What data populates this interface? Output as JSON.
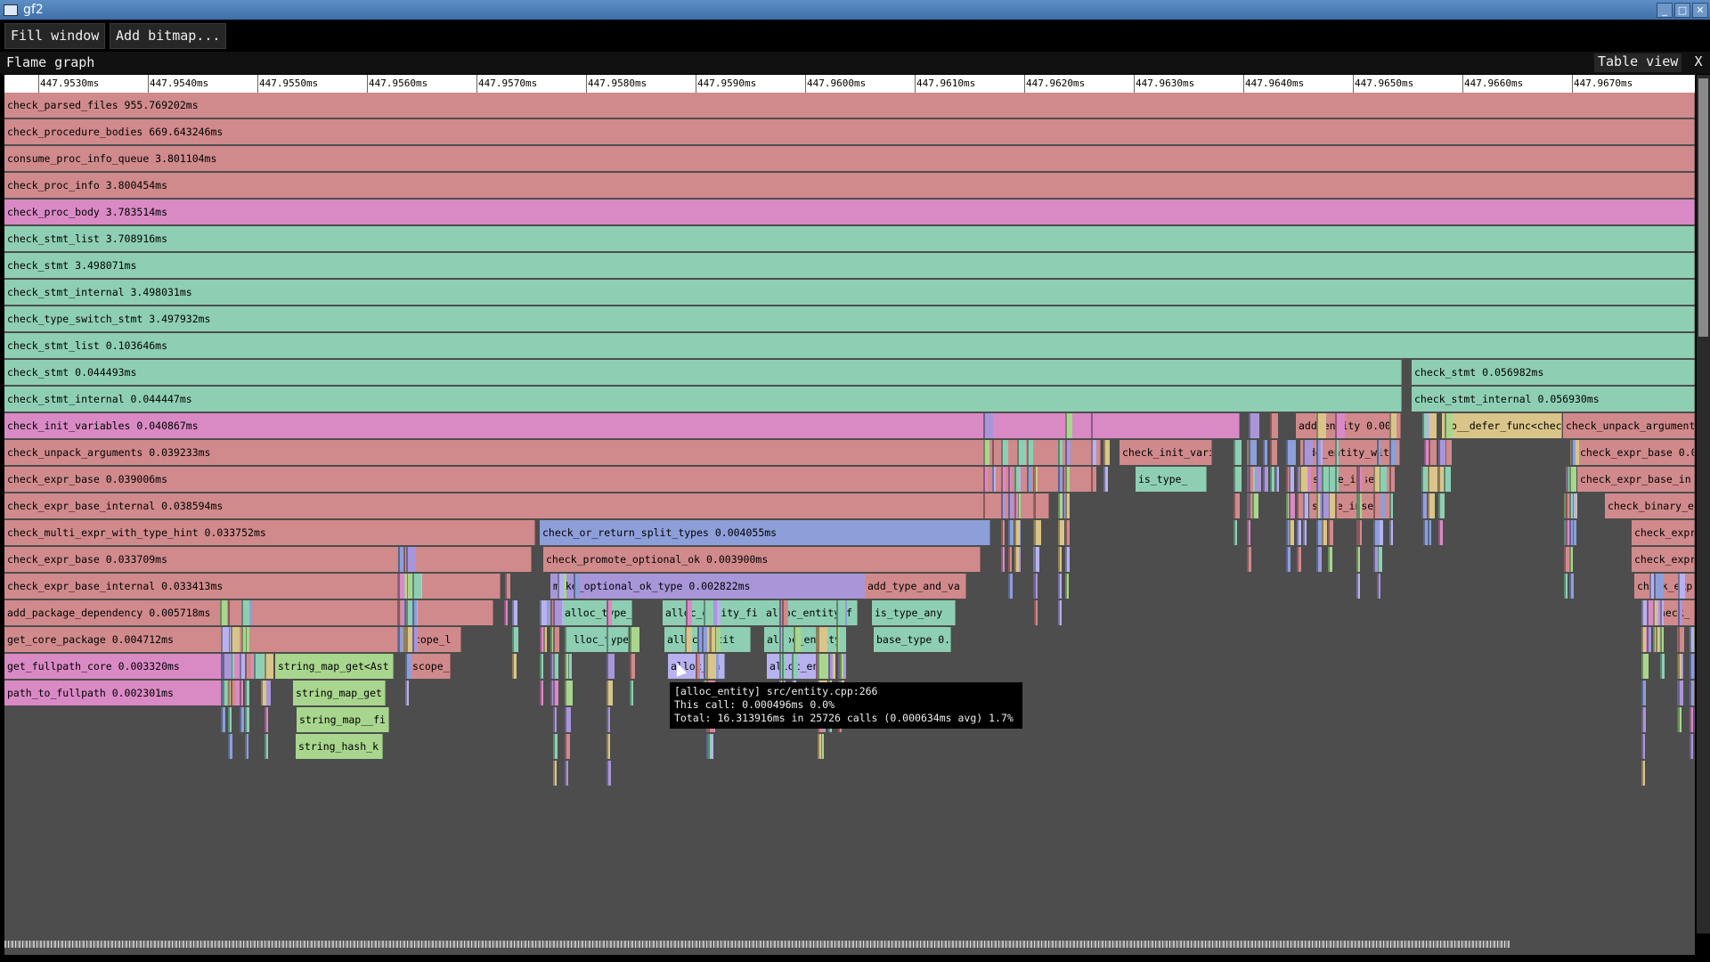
{
  "window": {
    "title": "gf2",
    "minimize": "_",
    "maximize": "□",
    "close": "✕"
  },
  "toolbar": {
    "fill_window": "Fill window",
    "add_bitmap": "Add bitmap..."
  },
  "panel": {
    "title": "Flame graph",
    "table_view": "Table view",
    "close": "X"
  },
  "ruler_ticks": [
    "447.9530ms",
    "447.9540ms",
    "447.9550ms",
    "447.9560ms",
    "447.9570ms",
    "447.9580ms",
    "447.9590ms",
    "447.9600ms",
    "447.9610ms",
    "447.9620ms",
    "447.9630ms",
    "447.9640ms",
    "447.9650ms",
    "447.9660ms",
    "447.9670ms"
  ],
  "colors": {
    "pink": "#d08a8c",
    "green": "#8ecfb3",
    "magenta": "#d98ac5",
    "blue": "#8d9fd9",
    "purple": "#a996d9",
    "yellow": "#d9c58a",
    "lime": "#a9d68e",
    "lavender": "#b7b2ef"
  },
  "frames": [
    {
      "row": 0,
      "label": "check_parsed_files 955.769202ms",
      "color": "pink"
    },
    {
      "row": 1,
      "label": "check_procedure_bodies 669.643246ms",
      "color": "pink"
    },
    {
      "row": 2,
      "label": "consume_proc_info_queue 3.801104ms",
      "color": "pink"
    },
    {
      "row": 3,
      "label": "check_proc_info 3.800454ms",
      "color": "pink"
    },
    {
      "row": 4,
      "label": "check_proc_body 3.783514ms",
      "color": "magenta"
    },
    {
      "row": 5,
      "label": "check_stmt_list 3.708916ms",
      "color": "green"
    },
    {
      "row": 6,
      "label": "check_stmt 3.498071ms",
      "color": "green"
    },
    {
      "row": 7,
      "label": "check_stmt_internal 3.498031ms",
      "color": "green"
    },
    {
      "row": 8,
      "label": "check_type_switch_stmt 3.497932ms",
      "color": "green"
    },
    {
      "row": 9,
      "label": "check_stmt_list 0.103646ms",
      "color": "green"
    },
    {
      "row": 10,
      "label": "check_stmt 0.044493ms",
      "color": "green"
    },
    {
      "row": 10,
      "label": "check_stmt 0.056982ms",
      "color": "green"
    },
    {
      "row": 11,
      "label": "check_stmt_internal 0.044447ms",
      "color": "green"
    },
    {
      "row": 11,
      "label": "check_stmt_internal 0.056930ms",
      "color": "green"
    },
    {
      "row": 12,
      "label": "check_init_variables 0.040867ms",
      "color": "magenta"
    },
    {
      "row": 12,
      "label": "add_entity 0.00",
      "color": "pink"
    },
    {
      "row": 12,
      "label": "gb__defer_func<chec",
      "color": "yellow"
    },
    {
      "row": 12,
      "label": "check_unpack_argument",
      "color": "pink"
    },
    {
      "row": 13,
      "label": "check_unpack_arguments 0.039233ms",
      "color": "pink"
    },
    {
      "row": 13,
      "label": "check_init_variable",
      "color": "pink"
    },
    {
      "row": 13,
      "label": "add_entity_with",
      "color": "pink"
    },
    {
      "row": 13,
      "label": "check_expr_base 0.0",
      "color": "pink"
    },
    {
      "row": 14,
      "label": "check_expr_base 0.039006ms",
      "color": "pink"
    },
    {
      "row": 14,
      "label": "is_type_",
      "color": "green"
    },
    {
      "row": 14,
      "label": "scope_insert",
      "color": "pink"
    },
    {
      "row": 14,
      "label": "check_expr_base_in",
      "color": "pink"
    },
    {
      "row": 15,
      "label": "check_expr_base_internal 0.038594ms",
      "color": "pink"
    },
    {
      "row": 15,
      "label": "scope_insert",
      "color": "pink"
    },
    {
      "row": 15,
      "label": "check_binary_e",
      "color": "pink"
    },
    {
      "row": 16,
      "label": "check_multi_expr_with_type_hint 0.033752ms",
      "color": "pink"
    },
    {
      "row": 16,
      "label": "check_or_return_split_types 0.004055ms",
      "color": "blue"
    },
    {
      "row": 16,
      "label": "check_expr",
      "color": "pink"
    },
    {
      "row": 17,
      "label": "check_expr_base 0.033709ms",
      "color": "pink"
    },
    {
      "row": 17,
      "label": "check_promote_optional_ok 0.003900ms",
      "color": "pink"
    },
    {
      "row": 17,
      "label": "check_expr",
      "color": "pink"
    },
    {
      "row": 18,
      "label": "check_expr_base_internal 0.033413ms",
      "color": "pink"
    },
    {
      "row": 18,
      "label": "make_optional_ok_type 0.002822ms",
      "color": "purple"
    },
    {
      "row": 18,
      "label": "add_type_and_va",
      "color": "pink"
    },
    {
      "row": 18,
      "label": "check_exp",
      "color": "pink"
    },
    {
      "row": 19,
      "label": "add_package_dependency 0.005718ms",
      "color": "pink"
    },
    {
      "row": 19,
      "label": "alloc_type_",
      "color": "green"
    },
    {
      "row": 19,
      "label": "alloc_entity_fi",
      "color": "green"
    },
    {
      "row": 19,
      "label": "alloc_entity_f",
      "color": "green"
    },
    {
      "row": 19,
      "label": "is_type_any",
      "color": "green"
    },
    {
      "row": 19,
      "label": "check_",
      "color": "pink"
    },
    {
      "row": 20,
      "label": "get_core_package 0.004712ms",
      "color": "pink"
    },
    {
      "row": 20,
      "label": "scope_l",
      "color": "pink"
    },
    {
      "row": 20,
      "label": "alloc_type",
      "color": "green"
    },
    {
      "row": 20,
      "label": "alloc_entit",
      "color": "green"
    },
    {
      "row": 20,
      "label": "alloc_entity",
      "color": "green"
    },
    {
      "row": 20,
      "label": "base_type 0.",
      "color": "green"
    },
    {
      "row": 21,
      "label": "get_fullpath_core 0.003320ms",
      "color": "magenta"
    },
    {
      "row": 21,
      "label": "string_map_get<Ast",
      "color": "lime"
    },
    {
      "row": 21,
      "label": "scope_",
      "color": "pink"
    },
    {
      "row": 21,
      "label": "alloc_en",
      "color": "lavender"
    },
    {
      "row": 21,
      "label": "alloc_en",
      "color": "lavender"
    },
    {
      "row": 22,
      "label": "path_to_fullpath 0.002301ms",
      "color": "magenta"
    },
    {
      "row": 22,
      "label": "string_map_get",
      "color": "lime"
    },
    {
      "row": 23,
      "label": "string_map__fi",
      "color": "lime"
    },
    {
      "row": 24,
      "label": "string_hash_k",
      "color": "lime"
    }
  ],
  "tooltip": {
    "line1": "[alloc_entity] src/entity.cpp:266",
    "line2": "This call: 0.000496ms 0.0%",
    "line3": "Total: 16.313916ms in 25726 calls (0.000634ms avg) 1.7%"
  }
}
